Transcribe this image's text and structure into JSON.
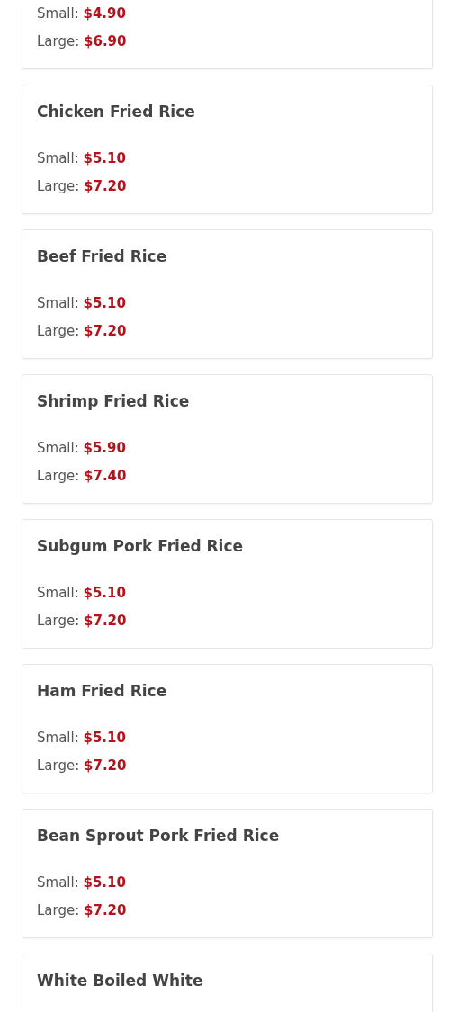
{
  "menu_items": [
    {
      "prices": [
        {
          "label": "Small:",
          "price": "$4.90"
        },
        {
          "label": "Large:",
          "price": "$6.90"
        }
      ]
    },
    {
      "name": "Chicken Fried Rice",
      "prices": [
        {
          "label": "Small:",
          "price": "$5.10"
        },
        {
          "label": "Large:",
          "price": "$7.20"
        }
      ]
    },
    {
      "name": "Beef Fried Rice",
      "prices": [
        {
          "label": "Small:",
          "price": "$5.10"
        },
        {
          "label": "Large:",
          "price": "$7.20"
        }
      ]
    },
    {
      "name": "Shrimp Fried Rice",
      "prices": [
        {
          "label": "Small:",
          "price": "$5.90"
        },
        {
          "label": "Large:",
          "price": "$7.40"
        }
      ]
    },
    {
      "name": "Subgum Pork Fried Rice",
      "prices": [
        {
          "label": "Small:",
          "price": "$5.10"
        },
        {
          "label": "Large:",
          "price": "$7.20"
        }
      ]
    },
    {
      "name": "Ham Fried Rice",
      "prices": [
        {
          "label": "Small:",
          "price": "$5.10"
        },
        {
          "label": "Large:",
          "price": "$7.20"
        }
      ]
    },
    {
      "name": "Bean Sprout Pork Fried Rice",
      "prices": [
        {
          "label": "Small:",
          "price": "$5.10"
        },
        {
          "label": "Large:",
          "price": "$7.20"
        }
      ]
    },
    {
      "name": "White Boiled White"
    }
  ]
}
